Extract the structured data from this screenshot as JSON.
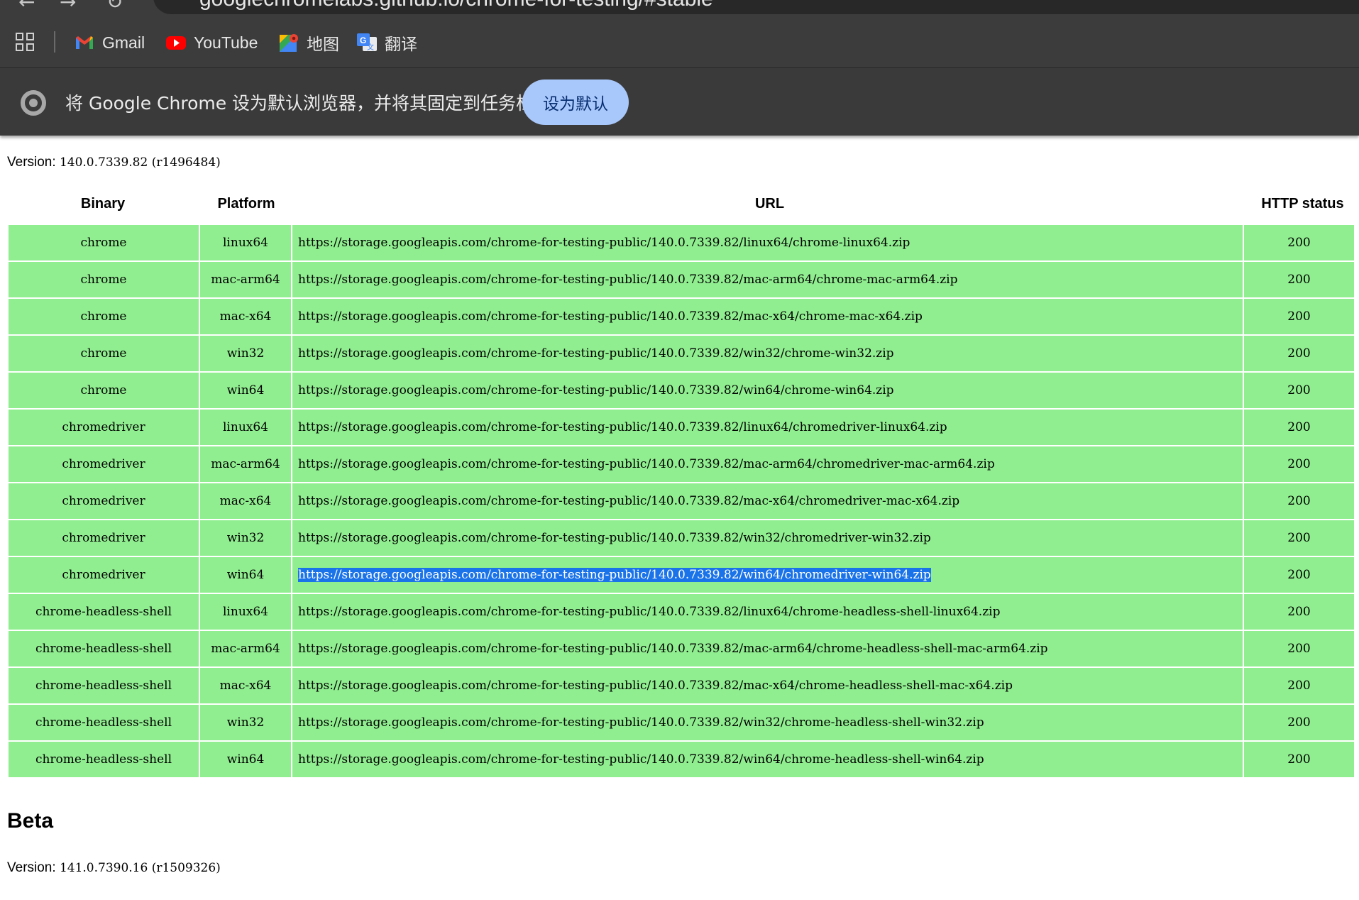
{
  "browser": {
    "address_bar_text": "googlechromelabs.github.io/chrome-for-testing/#stable",
    "bookmarks": [
      {
        "label": "Gmail",
        "icon": "gmail-icon"
      },
      {
        "label": "YouTube",
        "icon": "youtube-icon"
      },
      {
        "label": "地图",
        "icon": "maps-icon"
      },
      {
        "label": "翻译",
        "icon": "translate-icon"
      }
    ],
    "infobar": {
      "message": "将 Google Chrome 设为默认浏览器，并将其固定到任务栏",
      "button_label": "设为默认"
    }
  },
  "stable": {
    "version_label": "Version:",
    "version_value": "140.0.7339.82 (r1496484)",
    "columns": [
      "Binary",
      "Platform",
      "URL",
      "HTTP status"
    ],
    "rows": [
      {
        "binary": "chrome",
        "platform": "linux64",
        "url": "https://storage.googleapis.com/chrome-for-testing-public/140.0.7339.82/linux64/chrome-linux64.zip",
        "status": "200"
      },
      {
        "binary": "chrome",
        "platform": "mac-arm64",
        "url": "https://storage.googleapis.com/chrome-for-testing-public/140.0.7339.82/mac-arm64/chrome-mac-arm64.zip",
        "status": "200"
      },
      {
        "binary": "chrome",
        "platform": "mac-x64",
        "url": "https://storage.googleapis.com/chrome-for-testing-public/140.0.7339.82/mac-x64/chrome-mac-x64.zip",
        "status": "200"
      },
      {
        "binary": "chrome",
        "platform": "win32",
        "url": "https://storage.googleapis.com/chrome-for-testing-public/140.0.7339.82/win32/chrome-win32.zip",
        "status": "200"
      },
      {
        "binary": "chrome",
        "platform": "win64",
        "url": "https://storage.googleapis.com/chrome-for-testing-public/140.0.7339.82/win64/chrome-win64.zip",
        "status": "200"
      },
      {
        "binary": "chromedriver",
        "platform": "linux64",
        "url": "https://storage.googleapis.com/chrome-for-testing-public/140.0.7339.82/linux64/chromedriver-linux64.zip",
        "status": "200"
      },
      {
        "binary": "chromedriver",
        "platform": "mac-arm64",
        "url": "https://storage.googleapis.com/chrome-for-testing-public/140.0.7339.82/mac-arm64/chromedriver-mac-arm64.zip",
        "status": "200"
      },
      {
        "binary": "chromedriver",
        "platform": "mac-x64",
        "url": "https://storage.googleapis.com/chrome-for-testing-public/140.0.7339.82/mac-x64/chromedriver-mac-x64.zip",
        "status": "200"
      },
      {
        "binary": "chromedriver",
        "platform": "win32",
        "url": "https://storage.googleapis.com/chrome-for-testing-public/140.0.7339.82/win32/chromedriver-win32.zip",
        "status": "200"
      },
      {
        "binary": "chromedriver",
        "platform": "win64",
        "url": "https://storage.googleapis.com/chrome-for-testing-public/140.0.7339.82/win64/chromedriver-win64.zip",
        "status": "200",
        "selected": true
      },
      {
        "binary": "chrome-headless-shell",
        "platform": "linux64",
        "url": "https://storage.googleapis.com/chrome-for-testing-public/140.0.7339.82/linux64/chrome-headless-shell-linux64.zip",
        "status": "200"
      },
      {
        "binary": "chrome-headless-shell",
        "platform": "mac-arm64",
        "url": "https://storage.googleapis.com/chrome-for-testing-public/140.0.7339.82/mac-arm64/chrome-headless-shell-mac-arm64.zip",
        "status": "200"
      },
      {
        "binary": "chrome-headless-shell",
        "platform": "mac-x64",
        "url": "https://storage.googleapis.com/chrome-for-testing-public/140.0.7339.82/mac-x64/chrome-headless-shell-mac-x64.zip",
        "status": "200"
      },
      {
        "binary": "chrome-headless-shell",
        "platform": "win32",
        "url": "https://storage.googleapis.com/chrome-for-testing-public/140.0.7339.82/win32/chrome-headless-shell-win32.zip",
        "status": "200"
      },
      {
        "binary": "chrome-headless-shell",
        "platform": "win64",
        "url": "https://storage.googleapis.com/chrome-for-testing-public/140.0.7339.82/win64/chrome-headless-shell-win64.zip",
        "status": "200"
      }
    ]
  },
  "beta": {
    "heading": "Beta",
    "version_label": "Version:",
    "version_value": "141.0.7390.16 (r1509326)"
  },
  "colors": {
    "row_ok": "#90ee90",
    "selection": "#1a73e8",
    "infobar_button": "#a8c7fa"
  }
}
